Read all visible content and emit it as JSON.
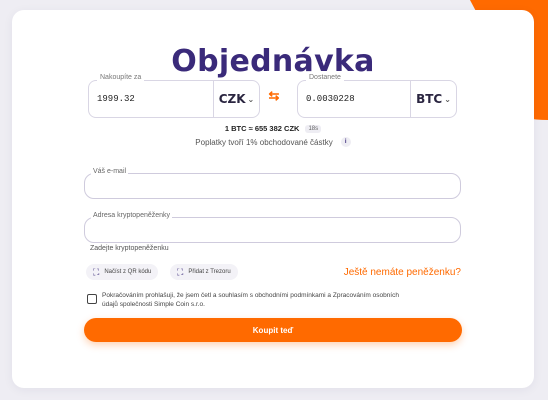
{
  "title": "Objednávka",
  "from": {
    "label": "Nakoupíte za",
    "value": "1999.32",
    "currency": "CZK"
  },
  "to": {
    "label": "Dostanete",
    "value": "0.0030228",
    "currency": "BTC"
  },
  "rate": {
    "text": "1 BTC ≈ 655 382 CZK",
    "timer": "18s"
  },
  "fees": {
    "text": "Poplatky tvoří 1% obchodované částky",
    "info_icon": "i"
  },
  "email": {
    "label": "Váš e-mail",
    "value": ""
  },
  "wallet": {
    "label": "Adresa kryptopeněženky",
    "value": "",
    "hint": "Zadejte kryptopeněženku"
  },
  "chips": {
    "qr": "Načíst z QR kódu",
    "trezor": "Přidat z Trezoru"
  },
  "no_wallet_link": "Ještě nemáte peněženku?",
  "consent": {
    "checked": false,
    "text": "Pokračováním prohlašuji, že jsem četl a souhlasím s obchodními podmínkami a Zpracováním osobních údajů společnosti Simple Coin s.r.o."
  },
  "buy_button": "Koupit teď",
  "colors": {
    "accent": "#ff6a00",
    "brand": "#3a2a7a"
  }
}
